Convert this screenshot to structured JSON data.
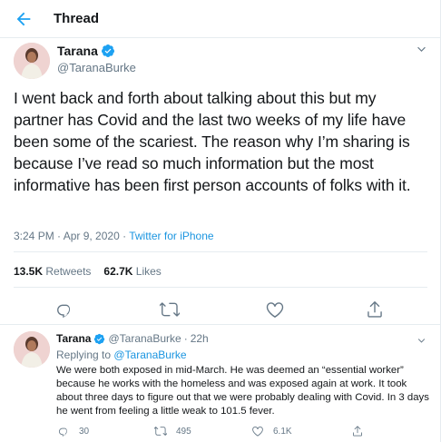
{
  "header": {
    "title": "Thread"
  },
  "tweet": {
    "name": "Tarana",
    "handle": "@TaranaBurke",
    "text": "I went back and forth about talking about this but my partner has Covid and the last two weeks of my life have been some of the scariest. The reason why I’m sharing is because I’ve read so much information but the most informative has been first person accounts of folks with it.",
    "time": "3:24 PM · Apr 9, 2020 · ",
    "source": "Twitter for iPhone",
    "retweets_count": "13.5K",
    "retweets_label": "Retweets",
    "likes_count": "62.7K",
    "likes_label": "Likes"
  },
  "reply": {
    "name": "Tarana",
    "handle": "@TaranaBurke",
    "dot": "·",
    "time": "22h",
    "replying_prefix": "Replying to ",
    "replying_to": "@TaranaBurke",
    "text": "We were both exposed in mid-March. He was deemed an “essential worker” because he works with the homeless and was exposed again at work. It took about three days to figure out that we were probably dealing with Covid. In 3 days he went from feeling a little weak to 101.5 fever.",
    "replies_count": "30",
    "retweets_count": "495",
    "likes_count": "6.1K"
  },
  "colors": {
    "accent": "#1da1f2",
    "link": "#1b95e0",
    "text": "#14171a",
    "muted": "#657786",
    "border": "#e6ecf0"
  },
  "icons": [
    "back-arrow-icon",
    "verified-badge-icon",
    "chevron-down-icon",
    "reply-icon",
    "retweet-icon",
    "like-icon",
    "share-icon"
  ]
}
